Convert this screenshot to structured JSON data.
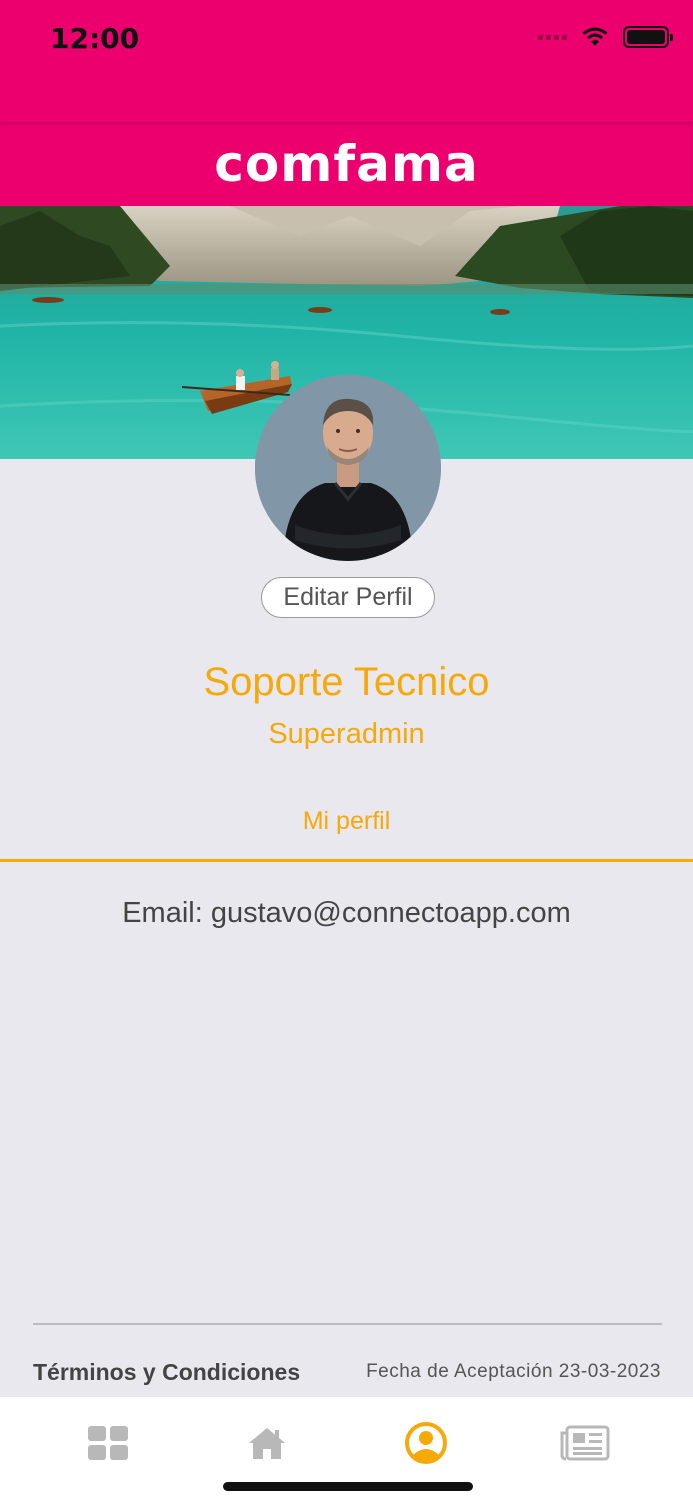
{
  "status_bar": {
    "time": "12:00",
    "icons": [
      "signal-icon",
      "wifi-icon",
      "battery-icon"
    ]
  },
  "header": {
    "logo_text": "comfama",
    "background_color": "#ec006e"
  },
  "profile": {
    "cover_image": "lake-with-boats-and-mountains",
    "avatar_image": "man-portrait",
    "edit_button_label": "Editar Perfil",
    "name": "Soporte Tecnico",
    "role": "Superadmin",
    "accent_color": "#f5a90a"
  },
  "tabs": {
    "active_label": "Mi perfil"
  },
  "details": {
    "email_line": "Email: gustavo@connectoapp.com"
  },
  "footer": {
    "terms_label": "Términos y Condiciones",
    "acceptance_text": "Fecha de Aceptación 23-03-2023"
  },
  "bottom_nav": {
    "items": [
      {
        "icon": "grid-icon",
        "active": false
      },
      {
        "icon": "home-icon",
        "active": false
      },
      {
        "icon": "user-icon",
        "active": true
      },
      {
        "icon": "newspaper-icon",
        "active": false
      }
    ],
    "active_color": "#f5a90a",
    "inactive_color": "#b8b8b8"
  }
}
